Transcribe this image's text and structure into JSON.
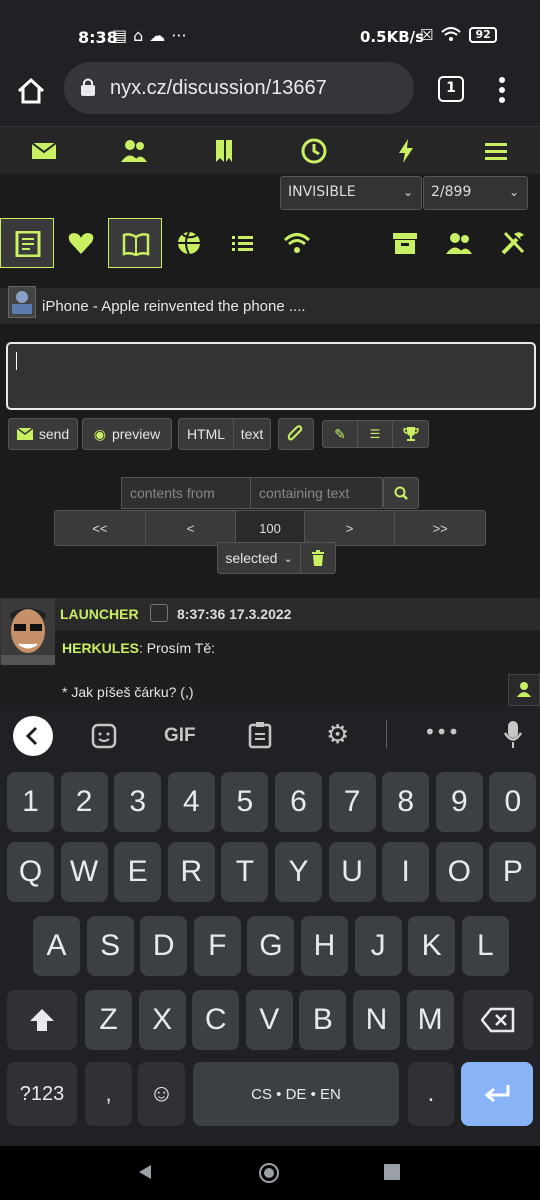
{
  "status_bar": {
    "time": "8:38",
    "icons": [
      "calendar-icon",
      "home-icon",
      "cloud-icon",
      "more-icon"
    ],
    "speed": "0.5KB/s",
    "battery": "92"
  },
  "browser": {
    "url": "nyx.cz/discussion/13667",
    "tabs_count": "1"
  },
  "nav": {
    "items": [
      "mail-icon",
      "people-icon",
      "bookmarks-icon",
      "history-icon",
      "lightning-icon",
      "hamburger-icon"
    ],
    "visibility_select": "INVISIBLE",
    "page_select": "2/899"
  },
  "toolbar": {
    "items": [
      "header-icon",
      "heart-icon",
      "book-icon",
      "ball-icon",
      "list-icon",
      "wifi-icon",
      "archive-icon",
      "users-icon",
      "tools-icon"
    ]
  },
  "topic": {
    "title": "iPhone - Apple reinvented the phone ...."
  },
  "compose": {
    "send": "send",
    "preview": "preview",
    "html": "HTML",
    "text": "text"
  },
  "search": {
    "from_placeholder": "contents from",
    "containing_placeholder": "containing text"
  },
  "pager": {
    "first": "<<",
    "prev": "<",
    "current": "100",
    "next": ">",
    "last": ">>",
    "selected": "selected"
  },
  "post": {
    "author": "LAUNCHER",
    "timestamp": "8:37:36 17.3.2022",
    "reply_to": "HERKULES",
    "line1_text": ": Prosím Tě:",
    "line2": "* Jak píšeš čárku? (,)"
  },
  "keyboard": {
    "gif": "GIF",
    "numbers": [
      "1",
      "2",
      "3",
      "4",
      "5",
      "6",
      "7",
      "8",
      "9",
      "0"
    ],
    "row1": [
      "Q",
      "W",
      "E",
      "R",
      "T",
      "Y",
      "U",
      "I",
      "O",
      "P"
    ],
    "row2": [
      "A",
      "S",
      "D",
      "F",
      "G",
      "H",
      "J",
      "K",
      "L"
    ],
    "row3": [
      "Z",
      "X",
      "C",
      "V",
      "B",
      "N",
      "M"
    ],
    "symbols": "?123",
    "comma": ",",
    "space": "CS • DE • EN",
    "period": "."
  },
  "colors": {
    "accent": "#c8f062",
    "enter": "#8ab4f8"
  }
}
